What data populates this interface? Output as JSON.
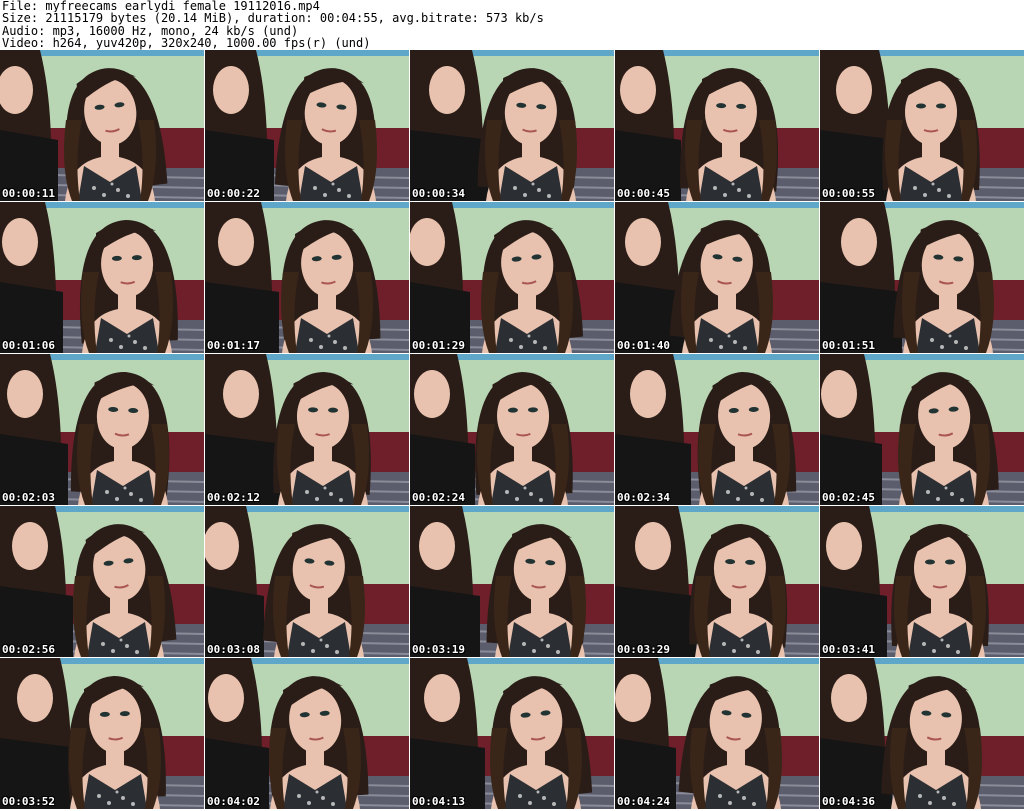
{
  "header": {
    "file_line": "File: myfreecams_earlydi_female_19112016.mp4",
    "size_line": "Size: 21115179 bytes (20.14 MiB), duration: 00:04:55, avg.bitrate: 573 kb/s",
    "audio_line": "Audio: mp3, 16000 Hz, mono, 24 kb/s (und)",
    "video_line": "Video: h264, yuv420p, 320x240, 1000.00 fps(r) (und)"
  },
  "thumbnails": [
    {
      "timestamp": "00:00:11"
    },
    {
      "timestamp": "00:00:22"
    },
    {
      "timestamp": "00:00:34"
    },
    {
      "timestamp": "00:00:45"
    },
    {
      "timestamp": "00:00:55"
    },
    {
      "timestamp": "00:01:06"
    },
    {
      "timestamp": "00:01:17"
    },
    {
      "timestamp": "00:01:29"
    },
    {
      "timestamp": "00:01:40"
    },
    {
      "timestamp": "00:01:51"
    },
    {
      "timestamp": "00:02:03"
    },
    {
      "timestamp": "00:02:12"
    },
    {
      "timestamp": "00:02:24"
    },
    {
      "timestamp": "00:02:34"
    },
    {
      "timestamp": "00:02:45"
    },
    {
      "timestamp": "00:02:56"
    },
    {
      "timestamp": "00:03:08"
    },
    {
      "timestamp": "00:03:19"
    },
    {
      "timestamp": "00:03:29"
    },
    {
      "timestamp": "00:03:41"
    },
    {
      "timestamp": "00:03:52"
    },
    {
      "timestamp": "00:04:02"
    },
    {
      "timestamp": "00:04:13"
    },
    {
      "timestamp": "00:04:24"
    },
    {
      "timestamp": "00:04:36"
    }
  ],
  "colors": {
    "background": "#ffffff",
    "header_text": "#000000",
    "timestamp_text": "#ffffff",
    "wall_green": "#b9d6b4",
    "sofa_red": "#6e1f2a",
    "hair_dark": "#2a1c17",
    "skin": "#e8c2ae",
    "clothing_black": "#151515"
  }
}
